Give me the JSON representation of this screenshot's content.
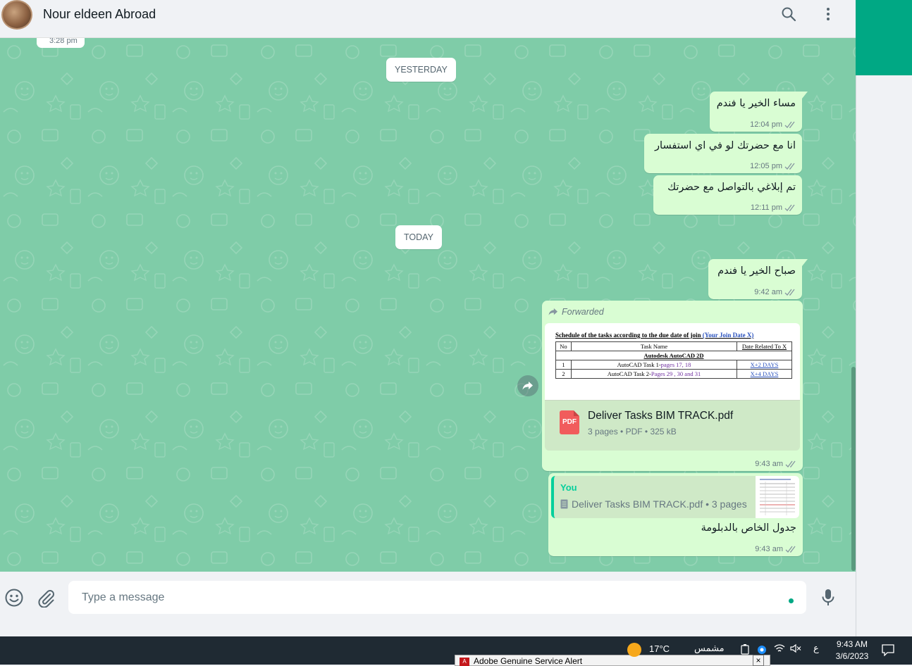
{
  "header": {
    "contact_name": "Nour eldeen Abroad"
  },
  "chat": {
    "previous_time": "3:28 pm",
    "day_yesterday": "YESTERDAY",
    "day_today": "TODAY",
    "messages": [
      {
        "text": "مساء الخير يا فندم",
        "time": "12:04 pm"
      },
      {
        "text": "انا مع حضرتك لو في اي استفسار",
        "time": "12:05 pm"
      },
      {
        "text": "تم إبلاغي بالتواصل مع حضرتك",
        "time": "12:11 pm"
      },
      {
        "text": "صباح الخير يا فندم",
        "time": "9:42 am"
      }
    ],
    "forwarded_doc": {
      "forwarded_label": "Forwarded",
      "preview_title": "Schedule of the tasks according to the due date of join",
      "preview_title_link": "(Your Join Date   X)",
      "preview_col_no": "No",
      "preview_col_task": "Task Name",
      "preview_col_date": "Date Related To X",
      "preview_section": "Autodesk AutoCAD 2D",
      "preview_row1_no": "1",
      "preview_row1_task": "AutoCAD Task 1-",
      "preview_row1_pages": "pages 17, 18",
      "preview_row1_date": "X+2 DAYS",
      "preview_row2_no": "2",
      "preview_row2_task": "AutoCAD Task 2-",
      "preview_row2_pages": "Pages 29 , 30 and 31",
      "preview_row2_date": "X+4 DAYS",
      "file_name": "Deliver Tasks BIM TRACK.pdf",
      "file_info": "3 pages • PDF • 325 kB",
      "icon_label": "PDF",
      "time": "9:43 am"
    },
    "reply": {
      "quote_author": "You",
      "quote_text": "Deliver Tasks BIM TRACK.pdf • 3 pages",
      "text": "جدول الخاص بالدبلومة",
      "time": "9:43 am"
    }
  },
  "footer": {
    "input_placeholder": "Type a message",
    "input_value": ""
  },
  "taskbar": {
    "adobe_alert": "Adobe Genuine Service Alert",
    "adobe_icon": "A",
    "close": "×",
    "weather": "17°C",
    "weather_text": "مشمس",
    "language": "ع",
    "time": "9:43 AM",
    "date": "3/6/2023"
  },
  "colors": {
    "accent": "#00a884",
    "outgoing_bubble": "#d9fdd3",
    "chat_background": "#7fcca8"
  }
}
